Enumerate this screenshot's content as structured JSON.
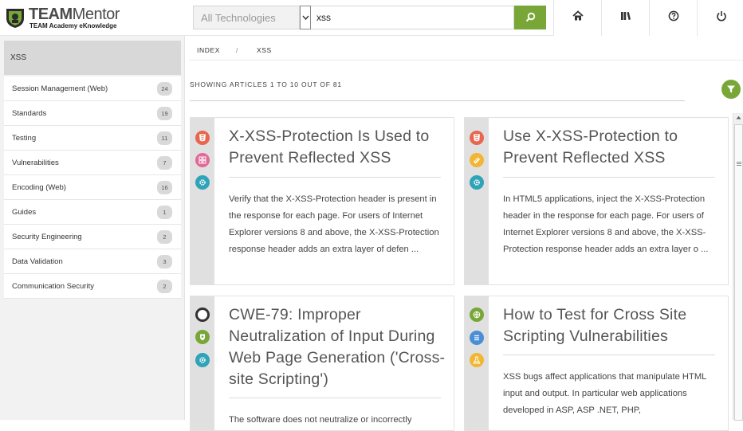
{
  "brand": {
    "title_bold": "TEAM",
    "title_light": "Mentor",
    "subtitle": "TEAM Academy eKnowledge"
  },
  "search": {
    "technology_placeholder": "All Technologies",
    "query": "xss"
  },
  "nav": {
    "icons": [
      "home-icon",
      "library-icon",
      "help-icon",
      "power-icon"
    ]
  },
  "sidebar": {
    "heading": "XSS",
    "items": [
      {
        "label": "Session Management (Web)",
        "count": "24"
      },
      {
        "label": "Standards",
        "count": "19"
      },
      {
        "label": "Testing",
        "count": "11"
      },
      {
        "label": "Vulnerabilities",
        "count": "7"
      },
      {
        "label": "Encoding (Web)",
        "count": "16"
      },
      {
        "label": "Guides",
        "count": "1"
      },
      {
        "label": "Security Engineering",
        "count": "2"
      },
      {
        "label": "Data Validation",
        "count": "3"
      },
      {
        "label": "Communication Security",
        "count": "2"
      }
    ]
  },
  "breadcrumb": {
    "root": "INDEX",
    "separator": "/",
    "current": "XSS"
  },
  "results": {
    "summary": "SHOWING ARTICLES 1 TO 10 OUT OF 81"
  },
  "articles": [
    {
      "title": "X-XSS-Protection Is Used to Prevent Reflected XSS",
      "description": "Verify that the X-XSS-Protection header is present in the response for each page. For users of Internet Explorer versions 8 and above, the X-XSS-Protection response header adds an extra layer of defen ...",
      "icons": [
        {
          "name": "html5-icon",
          "color": "#e8664f"
        },
        {
          "name": "apps-icon",
          "color": "#e06a98"
        },
        {
          "name": "gear-icon",
          "color": "#2fa3b7"
        }
      ]
    },
    {
      "title": "Use X-XSS-Protection to Prevent Reflected XSS",
      "description": "In HTML5 applications, inject the X-XSS-Protection header in the response for each page. For users of Internet Explorer versions 8 and above, the X-XSS-Protection response header adds an extra layer o ...",
      "icons": [
        {
          "name": "html5-icon",
          "color": "#e8664f"
        },
        {
          "name": "book-icon",
          "color": "#f0b634"
        },
        {
          "name": "gear-icon",
          "color": "#2fa3b7"
        }
      ]
    },
    {
      "title": "CWE-79: Improper Neutralization of Input During Web Page Generation ('Cross-site Scripting')",
      "description": "The software does not neutralize or incorrectly",
      "icons": [
        {
          "name": "ring-icon",
          "color": "#333333"
        },
        {
          "name": "shield-icon",
          "color": "#79a737"
        },
        {
          "name": "gear-icon",
          "color": "#2fa3b7"
        }
      ]
    },
    {
      "title": "How to Test for Cross Site Scripting Vulnerabilities",
      "description": "XSS bugs affect applications that manipulate HTML input and output. In particular web applications developed in ASP, ASP .NET, PHP,",
      "icons": [
        {
          "name": "globe-icon",
          "color": "#79a737"
        },
        {
          "name": "list-icon",
          "color": "#4a8fd6"
        },
        {
          "name": "flask-icon",
          "color": "#f0b634"
        }
      ]
    }
  ]
}
